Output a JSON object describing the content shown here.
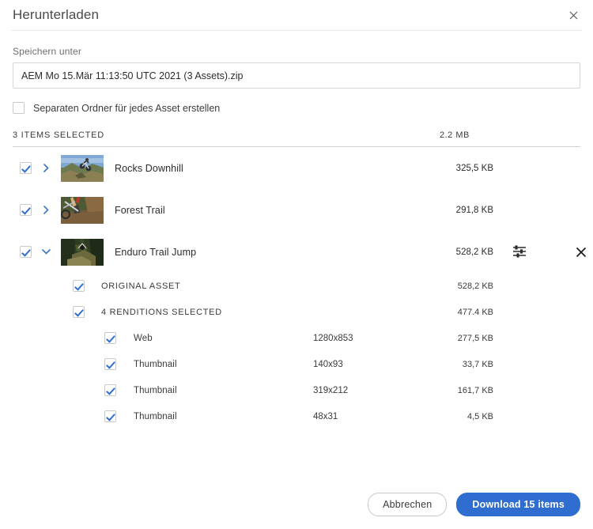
{
  "dialog": {
    "title": "Herunterladen",
    "close_icon": "close-icon"
  },
  "save_as": {
    "label": "Speichern unter",
    "value": "AEM Mo 15.Mär 11:13:50 UTC 2021 (3 Assets).zip",
    "placeholder": "AEM Mo 15.Mär 11:13:50 UTC 2021 (3 Assets).zip"
  },
  "options": {
    "separate_folder": {
      "label": "Separaten Ordner für jedes Asset erstellen",
      "checked": false
    }
  },
  "summary": {
    "label": "3 ITEMS SELECTED",
    "size": "2.2 MB"
  },
  "assets": [
    {
      "name": "Rocks Downhill",
      "size": "325,5 KB",
      "checked": true,
      "expanded": false,
      "chevron": "chevron-right-icon",
      "thumbnail": "mountain-biker-rocks"
    },
    {
      "name": "Forest Trail",
      "size": "291,8 KB",
      "checked": true,
      "expanded": false,
      "chevron": "chevron-right-icon",
      "thumbnail": "forest-trail-bike"
    },
    {
      "name": "Enduro Trail Jump",
      "size": "528,2 KB",
      "checked": true,
      "expanded": true,
      "chevron": "chevron-down-icon",
      "thumbnail": "enduro-forest-jump",
      "settings_icon": "sliders-icon",
      "remove_icon": "close-icon"
    }
  ],
  "expanded_detail": {
    "original_asset": {
      "label": "ORIGINAL ASSET",
      "size": "528,2 KB",
      "checked": true
    },
    "renditions_group": {
      "label": "4 RENDITIONS SELECTED",
      "size": "477.4 KB",
      "checked": true
    },
    "renditions": [
      {
        "name": "Web",
        "dimensions": "1280x853",
        "size": "277,5 KB",
        "checked": true
      },
      {
        "name": "Thumbnail",
        "dimensions": "140x93",
        "size": "33,7 KB",
        "checked": true
      },
      {
        "name": "Thumbnail",
        "dimensions": "319x212",
        "size": "161,7 KB",
        "checked": true
      },
      {
        "name": "Thumbnail",
        "dimensions": "48x31",
        "size": "4,5 KB",
        "checked": true
      }
    ]
  },
  "footer": {
    "cancel_label": "Abbrechen",
    "download_label": "Download 15 items"
  },
  "colors": {
    "accent": "#2f6ed0",
    "text": "#2b2b2b",
    "muted": "#6e6e6e",
    "border": "#d6d6d6"
  }
}
